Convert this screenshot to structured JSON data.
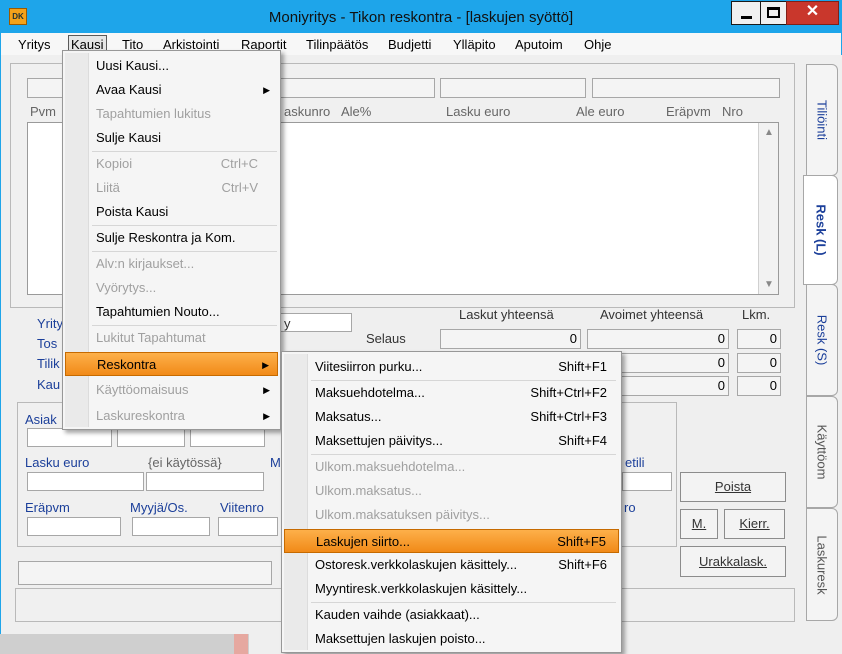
{
  "window": {
    "title": "Moniyritys - Tikon reskontra - [laskujen syöttö]",
    "app_icon_label": "DK",
    "close_glyph": "✕"
  },
  "menubar": [
    "Yritys",
    "Kausi",
    "Tito",
    "Arkistointi",
    "Raportit",
    "Tilinpäätös",
    "Budjetti",
    "Ylläpito",
    "Aputoim",
    "Ohje"
  ],
  "grid": {
    "headers": {
      "pvm": "Pvm",
      "laskunro": "askunro",
      "ale": "Ale%",
      "lasku_euro": "Lasku euro",
      "ale_euro": "Ale euro",
      "erapvm": "Eräpvm",
      "nro": "Nro"
    }
  },
  "summary": {
    "laskut_label": "Laskut yhteensä",
    "avoimet_label": "Avoimet yhteensä",
    "lkm_label": "Lkm.",
    "selaus_label": "Selaus",
    "y_fragment": "y",
    "rows": [
      {
        "laskut": "0",
        "avoimet": "0",
        "lkm": "0"
      },
      {
        "avoimet": "0",
        "lkm": "0"
      },
      {
        "avoimet": "0",
        "lkm": "0"
      }
    ]
  },
  "left_labels": [
    "Yrity",
    "Tos",
    "Tilik",
    "Kau"
  ],
  "form": {
    "asiak": "Asiak",
    "lasku_euro": "Lasku euro",
    "ei_kaytossa": "{ei käytössä}",
    "m_frag": "M",
    "erapvm": "Eräpvm",
    "myyja": "Myyjä/Os.",
    "viitenro": "Viitenro",
    "etili_frag": "etili",
    "ro_frag": "ro"
  },
  "buttons": {
    "poista": "Poista",
    "m": "M.",
    "kierr": "Kierr.",
    "urakkalask": "Urakkalask."
  },
  "tabs": [
    "Tiliöinti",
    "Resk (L)",
    "Resk (S)",
    "Käyttöom",
    "Laskuresk"
  ],
  "kausi_menu": [
    {
      "label": "Uusi Kausi...",
      "enabled": true
    },
    {
      "label": "Avaa Kausi",
      "enabled": true,
      "submenu": true
    },
    {
      "label": "Tapahtumien lukitus",
      "enabled": false
    },
    {
      "label": "Sulje Kausi",
      "enabled": true
    },
    {
      "label": "Kopioi",
      "shortcut": "Ctrl+C",
      "enabled": false
    },
    {
      "label": "Liitä",
      "shortcut": "Ctrl+V",
      "enabled": false
    },
    {
      "label": "Poista Kausi",
      "enabled": true
    },
    {
      "label": "Sulje Reskontra ja Kom.",
      "enabled": true
    },
    {
      "label": "Alv:n kirjaukset...",
      "enabled": false
    },
    {
      "label": "Vyörytys...",
      "enabled": false
    },
    {
      "label": "Tapahtumien Nouto...",
      "enabled": true
    },
    {
      "label": "Lukitut Tapahtumat",
      "enabled": false
    },
    {
      "label": "Reskontra",
      "enabled": true,
      "submenu": true,
      "highlighted": true
    },
    {
      "label": "Käyttöomaisuus",
      "enabled": false,
      "submenu": true
    },
    {
      "label": "Laskureskontra",
      "enabled": false,
      "submenu": true
    }
  ],
  "reskontra_menu": [
    {
      "label": "Viitesiirron purku...",
      "shortcut": "Shift+F1",
      "enabled": true
    },
    {
      "label": "Maksuehdotelma...",
      "shortcut": "Shift+Ctrl+F2",
      "enabled": true
    },
    {
      "label": "Maksatus...",
      "shortcut": "Shift+Ctrl+F3",
      "enabled": true
    },
    {
      "label": "Maksettujen päivitys...",
      "shortcut": "Shift+F4",
      "enabled": true
    },
    {
      "label": "Ulkom.maksuehdotelma...",
      "enabled": false
    },
    {
      "label": "Ulkom.maksatus...",
      "enabled": false
    },
    {
      "label": "Ulkom.maksatuksen päivitys...",
      "enabled": false
    },
    {
      "label": "Laskujen siirto...",
      "shortcut": "Shift+F5",
      "enabled": true,
      "highlighted": true
    },
    {
      "label": "Ostoresk.verkkolaskujen käsittely...",
      "shortcut": "Shift+F6",
      "enabled": true
    },
    {
      "label": "Myyntiresk.verkkolaskujen käsittely...",
      "enabled": true
    },
    {
      "label": "Kauden vaihde (asiakkaat)...",
      "enabled": true
    },
    {
      "label": "Maksettujen laskujen poisto...",
      "enabled": true
    }
  ]
}
